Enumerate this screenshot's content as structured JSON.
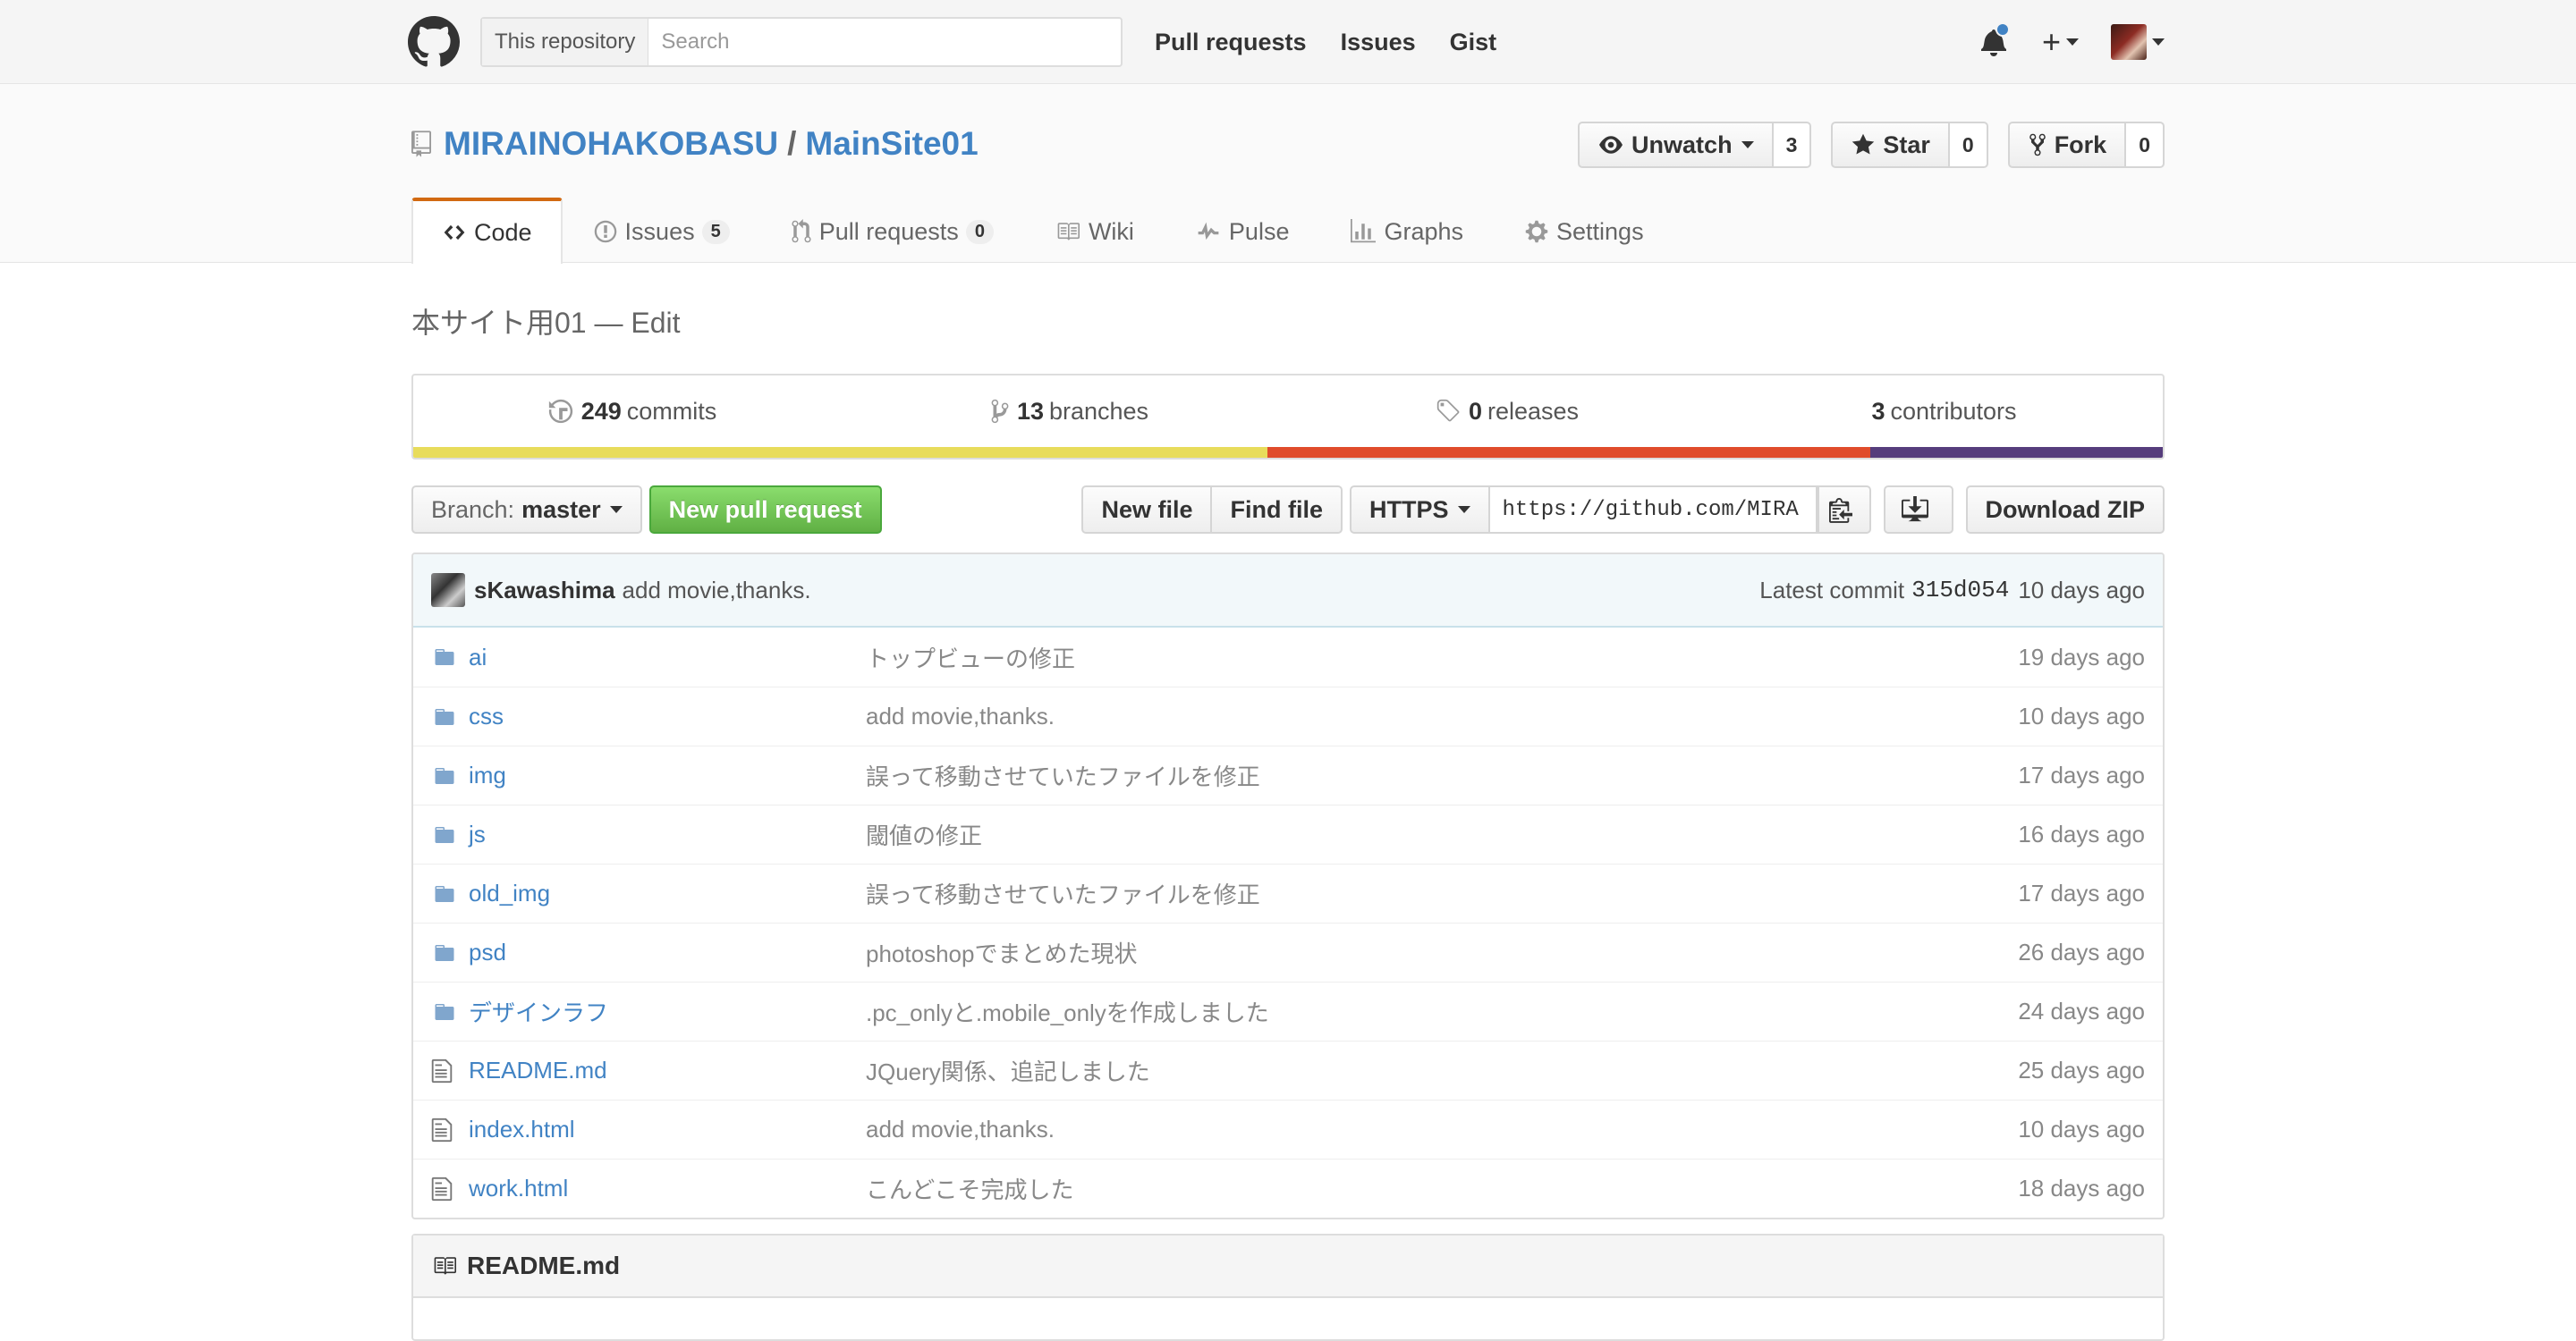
{
  "header": {
    "search_scope": "This repository",
    "search_placeholder": "Search",
    "nav": [
      "Pull requests",
      "Issues",
      "Gist"
    ]
  },
  "repo": {
    "owner": "MIRAINOHAKOBASU",
    "separator": "/",
    "name": "MainSite01",
    "watch_label": "Unwatch",
    "watch_count": "3",
    "star_label": "Star",
    "star_count": "0",
    "fork_label": "Fork",
    "fork_count": "0"
  },
  "tabs": [
    {
      "label": "Code",
      "selected": true
    },
    {
      "label": "Issues",
      "counter": "5"
    },
    {
      "label": "Pull requests",
      "counter": "0"
    },
    {
      "label": "Wiki"
    },
    {
      "label": "Pulse"
    },
    {
      "label": "Graphs"
    },
    {
      "label": "Settings"
    }
  ],
  "description": "本サイト用01 — Edit",
  "summary": {
    "commits_count": "249",
    "commits_label": "commits",
    "branches_count": "13",
    "branches_label": "branches",
    "releases_count": "0",
    "releases_label": "releases",
    "contributors_count": "3",
    "contributors_label": "contributors"
  },
  "language_bar": [
    {
      "color": "#e8dc5b",
      "fraction": 0.488
    },
    {
      "color": "#e04c2b",
      "fraction": 0.345
    },
    {
      "color": "#563d7c",
      "fraction": 0.167
    }
  ],
  "file_nav": {
    "branch_prefix": "Branch:",
    "branch_name": "master",
    "new_pr_label": "New pull request",
    "new_file_label": "New file",
    "find_file_label": "Find file",
    "protocol_label": "HTTPS",
    "clone_url": "https://github.com/MIRA",
    "download_zip_label": "Download ZIP"
  },
  "latest_commit": {
    "author": "sKawashima",
    "message": "add movie,thanks.",
    "prefix": "Latest commit",
    "sha": "315d054",
    "age": "10 days ago"
  },
  "files": [
    {
      "type": "dir",
      "name": "ai",
      "message": "トップビューの修正",
      "age": "19 days ago"
    },
    {
      "type": "dir",
      "name": "css",
      "message": "add movie,thanks.",
      "age": "10 days ago"
    },
    {
      "type": "dir",
      "name": "img",
      "message": "誤って移動させていたファイルを修正",
      "age": "17 days ago"
    },
    {
      "type": "dir",
      "name": "js",
      "message": "閾値の修正",
      "age": "16 days ago"
    },
    {
      "type": "dir",
      "name": "old_img",
      "message": "誤って移動させていたファイルを修正",
      "age": "17 days ago"
    },
    {
      "type": "dir",
      "name": "psd",
      "message": "photoshopでまとめた現状",
      "age": "26 days ago"
    },
    {
      "type": "dir",
      "name": "デザインラフ",
      "message": ".pc_onlyと.mobile_onlyを作成しました",
      "age": "24 days ago"
    },
    {
      "type": "file",
      "name": "README.md",
      "message": "JQuery関係、追記しました",
      "age": "25 days ago"
    },
    {
      "type": "file",
      "name": "index.html",
      "message": "add movie,thanks.",
      "age": "10 days ago"
    },
    {
      "type": "file",
      "name": "work.html",
      "message": "こんどこそ完成した",
      "age": "18 days ago"
    }
  ],
  "readme": {
    "title": "README.md"
  },
  "colors": {
    "link": "#4183c4",
    "tab_accent": "#d26911",
    "primary_green": "#6cc644",
    "notification_dot": "#4183c4"
  }
}
